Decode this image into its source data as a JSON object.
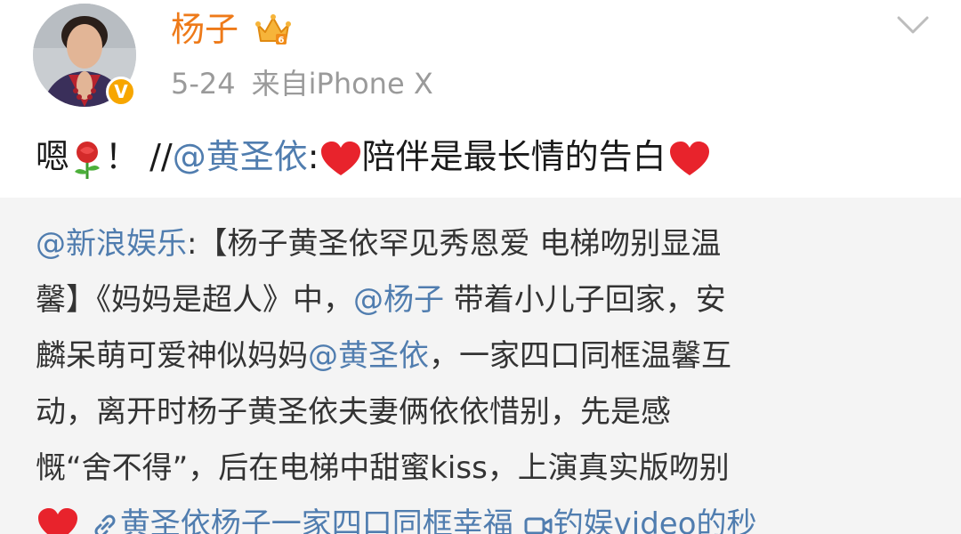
{
  "header": {
    "username": "杨子",
    "date": "5-24",
    "source": "来自iPhone X",
    "verified_icon": "verified-v-badge",
    "vip_icon": "vip-crown-icon",
    "menu_icon": "chevron-down-icon",
    "verified_letter": "V"
  },
  "post": {
    "prefix": "嗯",
    "emoji_rose": "rose-icon",
    "exclaim": "！",
    "slashes": "//",
    "mention": "@黄圣依",
    "colon": ":",
    "body": "陪伴是最长情的告白"
  },
  "quote": {
    "mention_source": "@新浪娱乐",
    "line1_rest": ":【杨子黄圣依罕见秀恩爱 电梯吻别显温",
    "line2_a": "馨】《妈妈是超人》中，",
    "line2_mention": "@杨子",
    "line2_b": " 带着小儿子回家，安",
    "line3_a": "麟呆萌可爱神似妈妈",
    "line3_mention": "@黄圣依",
    "line3_b": "，一家四口同框温馨互",
    "line4": "动，离开时杨子黄圣依夫妻俩依依惜别，先是感",
    "line5": "慨“舍不得”，后在电梯中甜蜜kiss，上演真实版吻别",
    "line6_link1": "黄圣依杨子一家四口同框幸福",
    "line6_link2": "钓娱video的秒",
    "colors": {
      "link": "#507daf",
      "username": "#ee7a19",
      "quote_bg": "#f4f4f4"
    }
  }
}
